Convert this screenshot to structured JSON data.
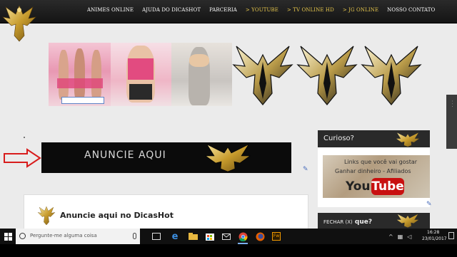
{
  "nav": {
    "items": [
      {
        "label": "ANIMES ONLINE",
        "gold": false
      },
      {
        "label": "AJUDA DO DICASHOT",
        "gold": false
      },
      {
        "label": "PARCERIA",
        "gold": false
      },
      {
        "label": "> YOUTUBE",
        "gold": true
      },
      {
        "label": "> TV ONLINE HD",
        "gold": true
      },
      {
        "label": "> JG ONLINE",
        "gold": true
      },
      {
        "label": "NOSSO CONTATO",
        "gold": false
      }
    ]
  },
  "ad": {
    "text": "ANUNCIE AQUI"
  },
  "post": {
    "title": "Anuncie aqui no DicasHot"
  },
  "sidebar": {
    "widget1": {
      "title": "Curioso?",
      "line1": "Links que você vai gostar",
      "line2": "Ganhar dinheiro - Afiliados",
      "yt_you": "You",
      "yt_tube": "Tube"
    },
    "widget2": {
      "title_prefix": "FECHAR (X)",
      "title_suffix": " que?"
    }
  },
  "taskbar": {
    "search_placeholder": "Pergunte-me alguma coisa",
    "time": "16:28",
    "date": "23/01/2017"
  },
  "colors": {
    "header_bg": "#1c1c1c",
    "gold": "#e7c74c",
    "ad_bg": "#0b0b0b",
    "arrow_red": "#d81c1c",
    "youtube_red": "#c81010"
  }
}
